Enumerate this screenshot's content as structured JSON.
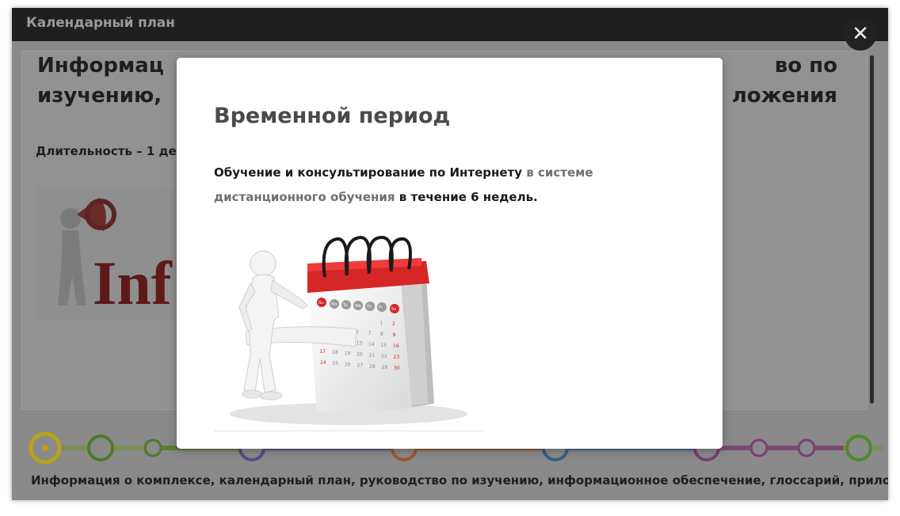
{
  "window": {
    "title": "Календарный план"
  },
  "close": {
    "glyph": "✕"
  },
  "background": {
    "heading_line1_left": "Информац",
    "heading_line1_right": "во по",
    "heading_line2_left": "изучению,",
    "heading_line2_right": "ложения",
    "duration": "Длительность – 1 де",
    "image_text": "Inf",
    "timeline_caption": "Информация о комплексе, календарный план, руководство по изучению, информационное обеспечение, глоссарий, приложе"
  },
  "modal": {
    "title": "Временной период",
    "text_part1": "Обучение и консультирование по Интернету ",
    "text_link": "в системе дистанционного обучения",
    "text_part2": " в течение 6 недель.",
    "calendar_days": [
      "Su",
      "Mo",
      "Tu",
      "We",
      "Th",
      "Fr",
      "Sa"
    ],
    "calendar_numbers": [
      "1",
      "2",
      "3",
      "4",
      "5",
      "6",
      "7",
      "8",
      "9",
      "10",
      "11",
      "12",
      "13",
      "14",
      "15",
      "16",
      "17",
      "18",
      "19",
      "20",
      "21",
      "22",
      "23",
      "24",
      "25",
      "26",
      "27",
      "28",
      "29",
      "30"
    ]
  },
  "colors": {
    "accent_red": "#e02020",
    "timeline": [
      "#d9c21a",
      "#5f9e2a",
      "#6a55a8",
      "#e0742a",
      "#3d7fc4",
      "#9b4a8e",
      "#6bbf3a"
    ]
  }
}
